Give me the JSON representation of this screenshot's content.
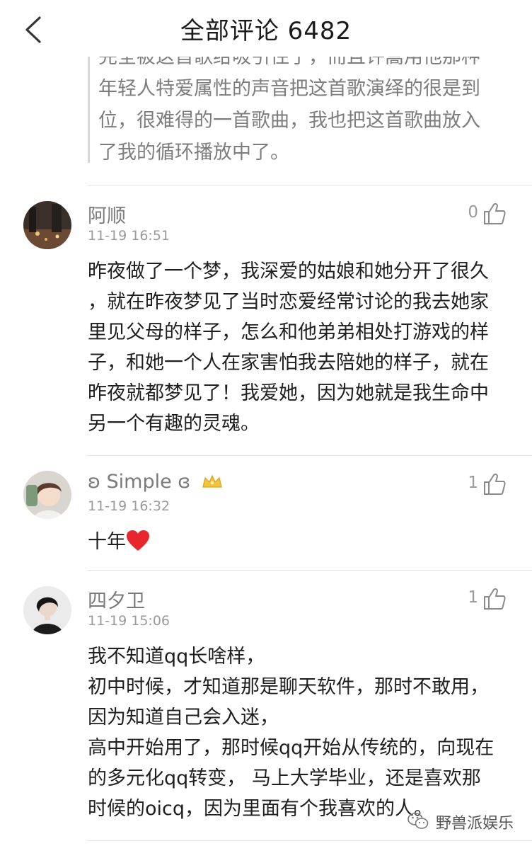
{
  "header": {
    "title": "全部评论 6482"
  },
  "quote": {
    "lines": [
      "完全被这首歌给吸引住了，而且许嵩用他那种",
      "年轻人特爱属性的声音把这首歌演绎的很是到",
      "位，很难得的一首歌曲，我也把这首歌曲放入",
      "了我的循环播放中了。"
    ]
  },
  "comments": [
    {
      "name": "阿顺",
      "time": "11-19 16:51",
      "likes": "0",
      "lines": [
        "昨夜做了一个梦，我深爱的姑娘和她分开了很久",
        "，就在昨夜梦见了当时恋爱经常讨论的我去她家",
        "里见父母的样子，怎么和他弟弟相处打游戏的样",
        "子，和她一个人在家害怕我去陪她的样子，就在",
        "昨夜就都梦见了！我爱她，因为她就是我生命中",
        "另一个有趣的灵魂。"
      ]
    },
    {
      "name": "ʚ Simple ɞ",
      "time": "11-19 16:32",
      "likes": "1",
      "lines": [
        "十年"
      ]
    },
    {
      "name": "四夕卫",
      "time": "11-19 15:06",
      "likes": "1",
      "lines": [
        "我不知道qq长啥样，",
        "初中时候，才知道那是聊天软件，那时不敢用，",
        "因为知道自己会入迷，",
        "高中开始用了，那时候qq开始从传统的，向现在",
        "的多元化qq转变， 马上大学毕业，还是喜欢那",
        "时候的oicq，因为里面有个我喜欢的人。"
      ]
    }
  ],
  "watermark": {
    "text": "野兽派娱乐"
  },
  "colors": {
    "heart": "#e8262b",
    "badge": "#f2c43a"
  }
}
